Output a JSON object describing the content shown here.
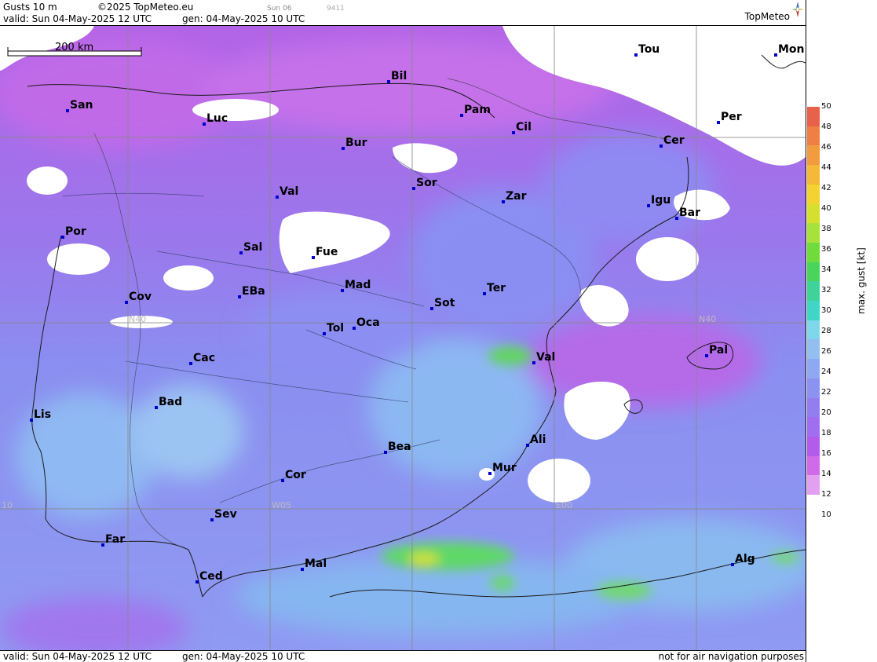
{
  "header": {
    "product": "Gusts 10 m",
    "copyright": "©2025 TopMeteo.eu",
    "day": "Sun 06",
    "code": "9411",
    "valid": "valid:  Sun  04-May-2025  12 UTC",
    "gen": "gen: 04-May-2025 10 UTC",
    "brand": "TopMeteo"
  },
  "footer": {
    "valid": "valid:  Sun  04-May-2025  12 UTC",
    "gen": "gen: 04-May-2025 10 UTC",
    "notice": "not for air navigation purposes"
  },
  "scale_bar": {
    "label": "200 km"
  },
  "legend": {
    "unit_label": "max. gust  [kt]",
    "ticks": [
      "50",
      "48",
      "46",
      "44",
      "42",
      "40",
      "38",
      "36",
      "34",
      "32",
      "30",
      "28",
      "26",
      "24",
      "22",
      "20",
      "18",
      "16",
      "14",
      "12",
      "10"
    ],
    "colors": [
      "#e8614b",
      "#ef7f45",
      "#f39c3f",
      "#f5b838",
      "#f2d330",
      "#d5e02e",
      "#a6e23a",
      "#6fdc3c",
      "#49d45c",
      "#3fd39a",
      "#3fd6c8",
      "#7fd7ec",
      "#92bff0",
      "#8fa8f4",
      "#8c92f2",
      "#927ef0",
      "#a06ef0",
      "#b35cec",
      "#d06ae8",
      "#e4a0f0"
    ]
  },
  "grid_labels": [
    "N40",
    "N40",
    "W05",
    "E00",
    "10"
  ],
  "cities": [
    {
      "name": "Tou"
    },
    {
      "name": "Mon"
    },
    {
      "name": "Bil"
    },
    {
      "name": "San"
    },
    {
      "name": "Pam"
    },
    {
      "name": "Luc"
    },
    {
      "name": "Cil"
    },
    {
      "name": "Per"
    },
    {
      "name": "Bur"
    },
    {
      "name": "Cer"
    },
    {
      "name": "Sor"
    },
    {
      "name": "Zar"
    },
    {
      "name": "Val"
    },
    {
      "name": "Igu"
    },
    {
      "name": "Bar"
    },
    {
      "name": "Por"
    },
    {
      "name": "Sal"
    },
    {
      "name": "Fue"
    },
    {
      "name": "Mad"
    },
    {
      "name": "Ter"
    },
    {
      "name": "EBa"
    },
    {
      "name": "Cov"
    },
    {
      "name": "Sot"
    },
    {
      "name": "Tol"
    },
    {
      "name": "Oca"
    },
    {
      "name": "Pal"
    },
    {
      "name": "Val"
    },
    {
      "name": "Cac"
    },
    {
      "name": "Bad"
    },
    {
      "name": "Lis"
    },
    {
      "name": "Ali"
    },
    {
      "name": "Bea"
    },
    {
      "name": "Mur"
    },
    {
      "name": "Cor"
    },
    {
      "name": "Sev"
    },
    {
      "name": "Far"
    },
    {
      "name": "Alg"
    },
    {
      "name": "Mal"
    },
    {
      "name": "Ced"
    }
  ]
}
